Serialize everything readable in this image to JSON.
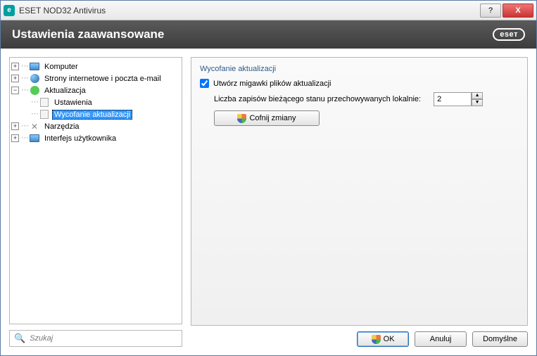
{
  "titlebar": {
    "app_icon_letter": "e",
    "title": "ESET NOD32 Antivirus",
    "help": "?",
    "close": "X"
  },
  "header": {
    "heading": "Ustawienia zaawansowane",
    "logo": "eseт"
  },
  "tree": {
    "komputer": "Komputer",
    "strony": "Strony internetowe i poczta e-mail",
    "aktualizacja": "Aktualizacja",
    "ustawienia": "Ustawienia",
    "wycofanie": "Wycofanie aktualizacji",
    "narzedzia": "Narzędzia",
    "interfejs": "Interfejs użytkownika"
  },
  "search": {
    "placeholder": "Szukaj"
  },
  "panel": {
    "title": "Wycofanie aktualizacji",
    "checkbox_label": "Utwórz migawki plików aktualizacji",
    "checkbox_checked": true,
    "count_label": "Liczba zapisów bieżącego stanu przechowywanych lokalnie:",
    "count_value": "2",
    "revert_button": "Cofnij zmiany"
  },
  "footer": {
    "ok": "OK",
    "cancel": "Anuluj",
    "default": "Domyślne"
  }
}
